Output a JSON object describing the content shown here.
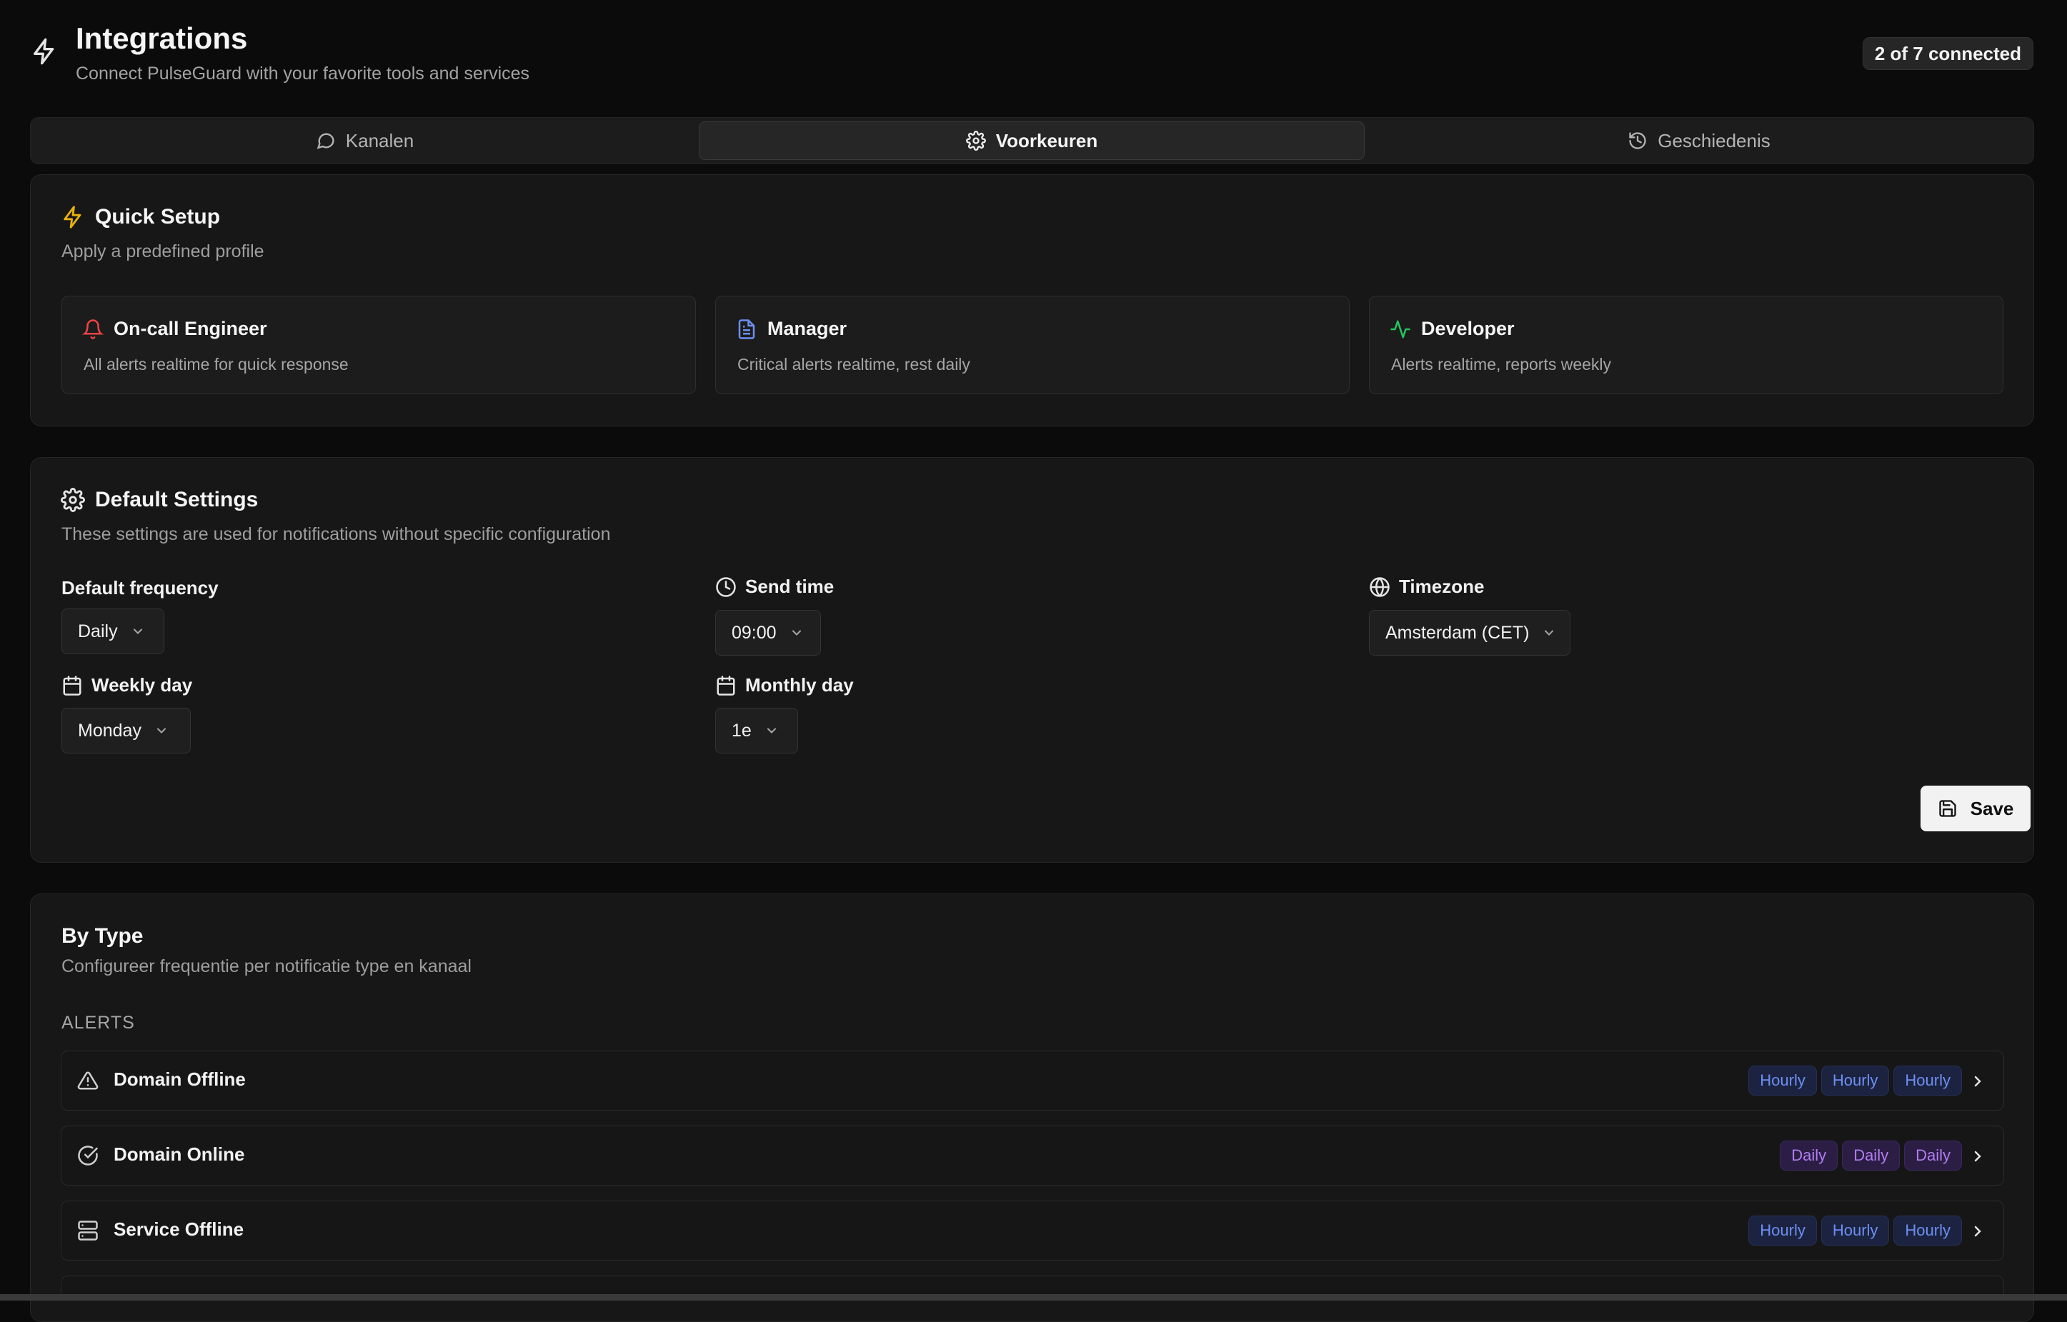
{
  "header": {
    "title": "Integrations",
    "subtitle": "Connect PulseGuard with your favorite tools and services",
    "connected_badge": "2 of 7 connected",
    "icon": "lightning-icon"
  },
  "tabs": [
    {
      "label": "Kanalen",
      "icon": "message-circle-icon",
      "active": false
    },
    {
      "label": "Voorkeuren",
      "icon": "gear-icon",
      "active": true
    },
    {
      "label": "Geschiedenis",
      "icon": "history-icon",
      "active": false
    }
  ],
  "quick_setup": {
    "title": "Quick Setup",
    "description": "Apply a predefined profile",
    "profiles": [
      {
        "title": "On-call Engineer",
        "description": "All alerts realtime for quick response",
        "icon": "bell-icon",
        "color": "#ef4444"
      },
      {
        "title": "Manager",
        "description": "Critical alerts realtime, rest daily",
        "icon": "document-icon",
        "color": "#6d8ff2"
      },
      {
        "title": "Developer",
        "description": "Alerts realtime, reports weekly",
        "icon": "activity-icon",
        "color": "#22c55e"
      }
    ]
  },
  "default_settings": {
    "title": "Default Settings",
    "description": "These settings are used for notifications without specific configuration",
    "fields": {
      "frequency": {
        "label": "Default frequency",
        "value": "Daily"
      },
      "send_time": {
        "label": "Send time",
        "value": "09:00"
      },
      "timezone": {
        "label": "Timezone",
        "value": "Amsterdam (CET)"
      },
      "weekly_day": {
        "label": "Weekly day",
        "value": "Monday"
      },
      "monthly_day": {
        "label": "Monthly day",
        "value": "1e"
      }
    },
    "save_label": "Save"
  },
  "by_type": {
    "title": "By Type",
    "description": "Configureer frequentie per notificatie type en kanaal",
    "section_label": "ALERTS",
    "rows": [
      {
        "name": "Domain Offline",
        "icon": "warning-triangle-icon",
        "badges": [
          "Hourly",
          "Hourly",
          "Hourly"
        ]
      },
      {
        "name": "Domain Online",
        "icon": "check-circle-icon",
        "badges": [
          "Daily",
          "Daily",
          "Daily"
        ]
      },
      {
        "name": "Service Offline",
        "icon": "server-icon",
        "badges": [
          "Hourly",
          "Hourly",
          "Hourly"
        ]
      }
    ]
  },
  "colors": {
    "accent_yellow": "#eab308",
    "hourly_text": "#6d8ff2",
    "daily_text": "#b07ef0"
  }
}
